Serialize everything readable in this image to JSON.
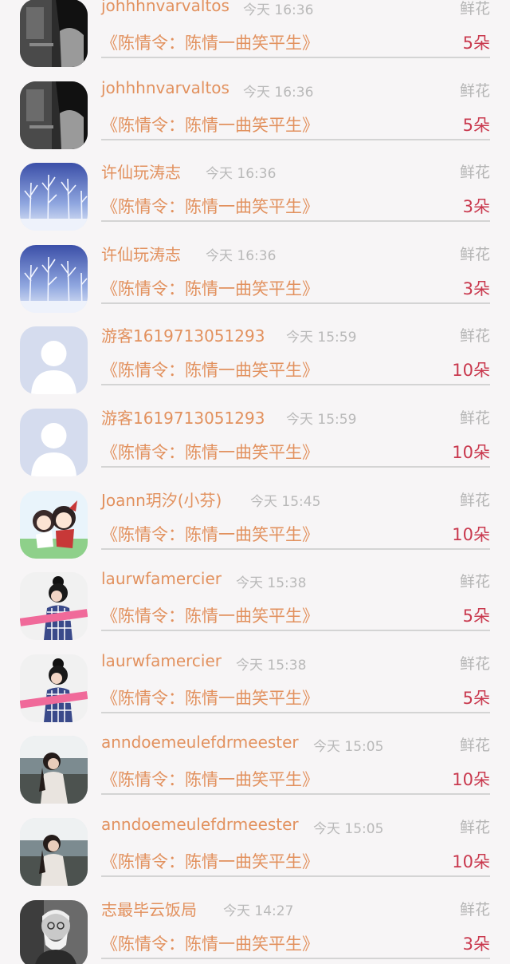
{
  "gift_records": [
    {
      "user": "johhhnvarvaltos",
      "time": "今天 16:36",
      "gift": "鲜花",
      "work": "《陈情令：陈情一曲笑平生》",
      "amount": "5朵",
      "avatar_icon": "bw-photo-avatar-icon"
    },
    {
      "user": "johhhnvarvaltos",
      "time": "今天 16:36",
      "gift": "鲜花",
      "work": "《陈情令：陈情一曲笑平生》",
      "amount": "5朵",
      "avatar_icon": "bw-photo-avatar-icon"
    },
    {
      "user": "许仙玩涛志",
      "time": "今天 16:36",
      "gift": "鲜花",
      "work": "《陈情令：陈情一曲笑平生》",
      "amount": "3朵",
      "avatar_icon": "snow-forest-avatar-icon"
    },
    {
      "user": "许仙玩涛志",
      "time": "今天 16:36",
      "gift": "鲜花",
      "work": "《陈情令：陈情一曲笑平生》",
      "amount": "3朵",
      "avatar_icon": "snow-forest-avatar-icon"
    },
    {
      "user": "游客1619713051293",
      "time": "今天 15:59",
      "gift": "鲜花",
      "work": "《陈情令：陈情一曲笑平生》",
      "amount": "10朵",
      "avatar_icon": "default-user-avatar-icon"
    },
    {
      "user": "游客1619713051293",
      "time": "今天 15:59",
      "gift": "鲜花",
      "work": "《陈情令：陈情一曲笑平生》",
      "amount": "10朵",
      "avatar_icon": "default-user-avatar-icon"
    },
    {
      "user": "Joann玥汐(小芬)",
      "time": "今天 15:45",
      "gift": "鲜花",
      "work": "《陈情令：陈情一曲笑平生》",
      "amount": "10朵",
      "avatar_icon": "anime-avatar-icon"
    },
    {
      "user": "laurwfamercier",
      "time": "今天 15:38",
      "gift": "鲜花",
      "work": "《陈情令：陈情一曲笑平生》",
      "amount": "5朵",
      "avatar_icon": "girl-photo-avatar-icon"
    },
    {
      "user": "laurwfamercier",
      "time": "今天 15:38",
      "gift": "鲜花",
      "work": "《陈情令：陈情一曲笑平生》",
      "amount": "5朵",
      "avatar_icon": "girl-photo-avatar-icon"
    },
    {
      "user": "anndoemeulefdrmeester",
      "time": "今天 15:05",
      "gift": "鲜花",
      "work": "《陈情令：陈情一曲笑平生》",
      "amount": "10朵",
      "avatar_icon": "seaside-girl-avatar-icon"
    },
    {
      "user": "anndoemeulefdrmeester",
      "time": "今天 15:05",
      "gift": "鲜花",
      "work": "《陈情令：陈情一曲笑平生》",
      "amount": "10朵",
      "avatar_icon": "seaside-girl-avatar-icon"
    },
    {
      "user": "志最毕云饭局",
      "time": "今天 14:27",
      "gift": "鲜花",
      "work": "《陈情令：陈情一曲笑平生》",
      "amount": "3朵",
      "avatar_icon": "old-man-avatar-icon"
    }
  ],
  "colors": {
    "background": "#f7f5f6",
    "username": "#e2915e",
    "work_title": "#e2915e",
    "amount": "#c9394e",
    "meta_text": "#b9b9b9",
    "divider": "#d4d4d4"
  }
}
